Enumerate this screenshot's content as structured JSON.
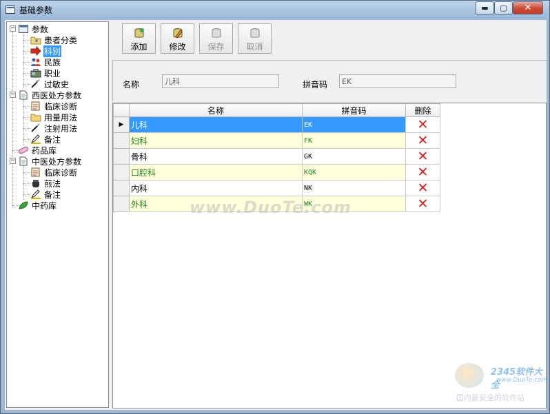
{
  "window": {
    "title": "基础参数",
    "controls": {
      "minimize": "▬",
      "maximize": "▢",
      "close": "✕"
    }
  },
  "tree": {
    "root1": {
      "label": "参数",
      "expander": "−"
    },
    "params": [
      {
        "label": "患者分类",
        "icon": "folder-person-icon"
      },
      {
        "label": "科别",
        "icon": "red-arrow-icon",
        "selected": true
      },
      {
        "label": "民族",
        "icon": "people-icon"
      },
      {
        "label": "职业",
        "icon": "briefcase-icon"
      },
      {
        "label": "过敏史",
        "icon": "syringe-icon"
      }
    ],
    "root2": {
      "label": "西医处方参数",
      "expander": "−"
    },
    "western": [
      {
        "label": "临床诊断",
        "icon": "clipboard-icon"
      },
      {
        "label": "用量用法",
        "icon": "folder-icon"
      },
      {
        "label": "注射用法",
        "icon": "syringe-icon"
      },
      {
        "label": "备注",
        "icon": "pencil-icon"
      }
    ],
    "root3": {
      "label": "药品库",
      "icon": "pill-icon"
    },
    "root4": {
      "label": "中医处方参数",
      "expander": "−"
    },
    "chinese": [
      {
        "label": "临床诊断",
        "icon": "clipboard-icon"
      },
      {
        "label": "煎法",
        "icon": "pot-icon"
      },
      {
        "label": "备注",
        "icon": "pencil-icon"
      }
    ],
    "root5": {
      "label": "中药库",
      "icon": "leaf-icon"
    }
  },
  "toolbar": {
    "add": "添加",
    "edit": "修改",
    "save": "保存",
    "cancel": "取消"
  },
  "form": {
    "name_label": "名称",
    "name_value": "儿科",
    "pinyin_label": "拼音码",
    "pinyin_value": "EK"
  },
  "grid": {
    "columns": [
      "名称",
      "拼音码",
      "删除"
    ],
    "rows": [
      {
        "name": "儿科",
        "code": "EK"
      },
      {
        "name": "妇科",
        "code": "FK"
      },
      {
        "name": "骨科",
        "code": "GK"
      },
      {
        "name": "口腔科",
        "code": "KQK"
      },
      {
        "name": "内科",
        "code": "NK"
      },
      {
        "name": "外科",
        "code": "WK"
      }
    ],
    "selected_row": 0,
    "row_indicator": "▶",
    "delete_glyph": "✕"
  },
  "watermark": {
    "site": "www.DuoTe.com",
    "logo_brand": "2345软件大全",
    "logo_url": "www.DuoTe.com",
    "logo_slogan": "国内最安全的软件站"
  },
  "colors": {
    "selection": "#3399ff",
    "alt_row": "#ffffdc",
    "alt_text": "#1e7e1e",
    "delete_red": "#d81e1e"
  }
}
